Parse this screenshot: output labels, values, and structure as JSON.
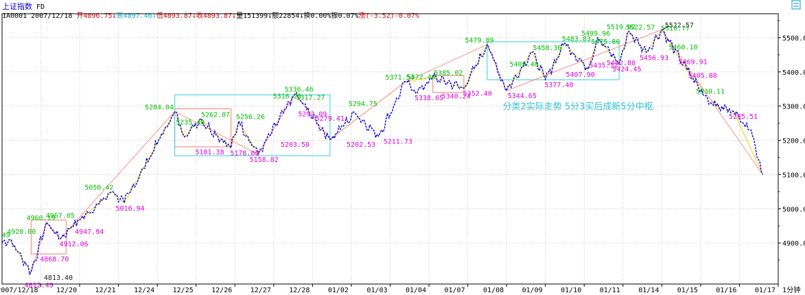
{
  "header": {
    "name": "上证指数",
    "type_code": "FD",
    "info": [
      {
        "text": "1A0001 2007/12/18 ",
        "color": "#000000"
      },
      {
        "text": "开4896.75↓",
        "color": "#e00000"
      },
      {
        "text": "高4897.46↓",
        "color": "#00b5d8"
      },
      {
        "text": "低4893.87↓",
        "color": "#e00000"
      },
      {
        "text": "收4893.87↓",
        "color": "#e00000"
      },
      {
        "text": "量151399↓",
        "color": "#000000"
      },
      {
        "text": "额22854↓",
        "color": "#000000"
      },
      {
        "text": "换0.00%",
        "color": "#000000"
      },
      {
        "text": "振0.07%",
        "color": "#000000"
      },
      {
        "text": "涨(-3.52)-0.07%",
        "color": "#e00000"
      }
    ],
    "corner_icon": "corner-scale-icon"
  },
  "chart_data": {
    "type": "line",
    "timeframe_label": "1分钟",
    "x_ticks": [
      "2007/12/18",
      "12/20",
      "12/21",
      "12/24",
      "12/25",
      "12/26",
      "12/27",
      "12/28",
      "01/02",
      "01/03",
      "01/04",
      "01/07",
      "01/08",
      "01/09",
      "01/10",
      "01/11",
      "01/14",
      "01/15",
      "01/16",
      "01/17"
    ],
    "ylim": [
      4780,
      5570
    ],
    "y_ticks": [
      4900,
      5000,
      5100,
      5200,
      5300,
      5400,
      5500
    ],
    "y_tick_labels": [
      "4900.00",
      "5000.00",
      "5100.00",
      "5200.00",
      "5300.00",
      "5400.00",
      "5500.00"
    ],
    "grid": true,
    "colors": {
      "price": "#0000e6",
      "stroke": "#e8d400",
      "segment": "#ff8a8a",
      "pivot_small": "#f08070",
      "pivot_big": "#30d0e0",
      "top_label": "#00c000",
      "bottom_label": "#e000e0",
      "note": "#30c0d8"
    },
    "stroke_points": [
      {
        "x": 0.2,
        "y": 4910
      },
      {
        "x": 0.75,
        "y": 4815
      },
      {
        "x": 1.15,
        "y": 4960
      },
      {
        "x": 1.5,
        "y": 4912
      },
      {
        "x": 1.8,
        "y": 4948
      },
      {
        "x": 2.85,
        "y": 5050
      },
      {
        "x": 3.15,
        "y": 5017
      },
      {
        "x": 4.45,
        "y": 5284
      },
      {
        "x": 4.7,
        "y": 5210
      },
      {
        "x": 5.1,
        "y": 5262
      },
      {
        "x": 5.9,
        "y": 5178
      },
      {
        "x": 6.1,
        "y": 5256
      },
      {
        "x": 6.6,
        "y": 5159
      },
      {
        "x": 7.55,
        "y": 5336
      },
      {
        "x": 8.45,
        "y": 5203
      },
      {
        "x": 10.4,
        "y": 5371
      },
      {
        "x": 11.1,
        "y": 5385
      },
      {
        "x": 11.9,
        "y": 5352
      },
      {
        "x": 12.5,
        "y": 5480
      },
      {
        "x": 13.0,
        "y": 5345
      },
      {
        "x": 13.65,
        "y": 5458
      },
      {
        "x": 14.0,
        "y": 5378
      },
      {
        "x": 14.5,
        "y": 5484
      },
      {
        "x": 15.1,
        "y": 5408
      },
      {
        "x": 15.35,
        "y": 5500
      },
      {
        "x": 15.9,
        "y": 5424
      },
      {
        "x": 16.15,
        "y": 5519
      },
      {
        "x": 16.6,
        "y": 5457
      },
      {
        "x": 17.0,
        "y": 5523
      },
      {
        "x": 17.65,
        "y": 5405
      },
      {
        "x": 18.4,
        "y": 5300
      },
      {
        "x": 18.85,
        "y": 5285
      },
      {
        "x": 19.6,
        "y": 5100
      }
    ],
    "segment_points": [
      {
        "x": 0.75,
        "y": 4815
      },
      {
        "x": 1.15,
        "y": 4960
      },
      {
        "x": 1.5,
        "y": 4912
      },
      {
        "x": 4.45,
        "y": 5284
      },
      {
        "x": 6.6,
        "y": 5159
      },
      {
        "x": 7.55,
        "y": 5336
      },
      {
        "x": 8.45,
        "y": 5203
      },
      {
        "x": 10.4,
        "y": 5371
      },
      {
        "x": 12.5,
        "y": 5480
      },
      {
        "x": 13.0,
        "y": 5345
      },
      {
        "x": 17.0,
        "y": 5523
      },
      {
        "x": 19.6,
        "y": 5100
      }
    ],
    "price_anchors": [
      {
        "x": 0,
        "y": 4900
      },
      {
        "x": 0.2,
        "y": 4910
      },
      {
        "x": 0.75,
        "y": 4815
      },
      {
        "x": 1.15,
        "y": 4960
      },
      {
        "x": 1.5,
        "y": 4912
      },
      {
        "x": 1.8,
        "y": 4948
      },
      {
        "x": 2.85,
        "y": 5050
      },
      {
        "x": 3.15,
        "y": 5017
      },
      {
        "x": 4.45,
        "y": 5284
      },
      {
        "x": 4.7,
        "y": 5210
      },
      {
        "x": 5.1,
        "y": 5262
      },
      {
        "x": 5.9,
        "y": 5178
      },
      {
        "x": 6.1,
        "y": 5256
      },
      {
        "x": 6.6,
        "y": 5159
      },
      {
        "x": 7.55,
        "y": 5336
      },
      {
        "x": 7.85,
        "y": 5290
      },
      {
        "x": 8.45,
        "y": 5203
      },
      {
        "x": 9.1,
        "y": 5280
      },
      {
        "x": 9.7,
        "y": 5212
      },
      {
        "x": 10.4,
        "y": 5371
      },
      {
        "x": 10.7,
        "y": 5339
      },
      {
        "x": 11.1,
        "y": 5385
      },
      {
        "x": 11.9,
        "y": 5352
      },
      {
        "x": 12.5,
        "y": 5480
      },
      {
        "x": 13.0,
        "y": 5345
      },
      {
        "x": 13.65,
        "y": 5458
      },
      {
        "x": 14.0,
        "y": 5378
      },
      {
        "x": 14.5,
        "y": 5484
      },
      {
        "x": 15.1,
        "y": 5408
      },
      {
        "x": 15.35,
        "y": 5500
      },
      {
        "x": 15.9,
        "y": 5424
      },
      {
        "x": 16.15,
        "y": 5519
      },
      {
        "x": 16.6,
        "y": 5457
      },
      {
        "x": 17.0,
        "y": 5523
      },
      {
        "x": 17.65,
        "y": 5405
      },
      {
        "x": 18.1,
        "y": 5330
      },
      {
        "x": 18.4,
        "y": 5300
      },
      {
        "x": 18.85,
        "y": 5285
      },
      {
        "x": 19.3,
        "y": 5230
      },
      {
        "x": 19.6,
        "y": 5100
      }
    ],
    "pivot_boxes": [
      {
        "kind": "small",
        "x0": 0.75,
        "x1": 1.65,
        "y0": 4868,
        "y1": 4967
      },
      {
        "kind": "small",
        "x0": 4.45,
        "x1": 5.9,
        "y0": 5181,
        "y1": 5292
      },
      {
        "kind": "big",
        "x0": 4.45,
        "x1": 8.45,
        "y0": 5155,
        "y1": 5333
      },
      {
        "kind": "small",
        "x0": 11.1,
        "x1": 11.9,
        "y0": 5340,
        "y1": 5389
      },
      {
        "kind": "big",
        "x0": 12.5,
        "x1": 15.9,
        "y0": 5377,
        "y1": 5488
      }
    ],
    "annotations": [
      {
        "text": "49",
        "x": 0.1,
        "y": 4910,
        "kind": "top"
      },
      {
        "text": "4920.00",
        "x": 0.5,
        "y": 4920,
        "kind": "top"
      },
      {
        "text": "4960.19",
        "x": 1.0,
        "y": 4960,
        "kind": "top"
      },
      {
        "text": "4967.05",
        "x": 1.5,
        "y": 4967,
        "kind": "top"
      },
      {
        "text": "4868.70",
        "x": 1.35,
        "y": 4868,
        "kind": "bottom"
      },
      {
        "text": "4912.06",
        "x": 1.85,
        "y": 4912,
        "kind": "bottom"
      },
      {
        "text": "4947.94",
        "x": 2.25,
        "y": 4948,
        "kind": "bottom"
      },
      {
        "text": "4812.49",
        "x": 0.95,
        "y": 4792,
        "kind": "bottom"
      },
      {
        "text": "4813.40",
        "x": 1.45,
        "y": 4800,
        "kind": "neutral"
      },
      {
        "text": "5050.42",
        "x": 2.5,
        "y": 5050,
        "kind": "top"
      },
      {
        "text": "5016.94",
        "x": 3.3,
        "y": 5017,
        "kind": "bottom"
      },
      {
        "text": "5284.04",
        "x": 4.05,
        "y": 5284,
        "kind": "top"
      },
      {
        "text": "5235.40",
        "x": 4.85,
        "y": 5240,
        "kind": "top"
      },
      {
        "text": "5262.07",
        "x": 5.5,
        "y": 5262,
        "kind": "top"
      },
      {
        "text": "5181.38",
        "x": 5.35,
        "y": 5181,
        "kind": "bottom"
      },
      {
        "text": "5178.00",
        "x": 6.25,
        "y": 5178,
        "kind": "bottom"
      },
      {
        "text": "5256.26",
        "x": 6.4,
        "y": 5256,
        "kind": "top"
      },
      {
        "text": "5158.82",
        "x": 6.75,
        "y": 5159,
        "kind": "bottom"
      },
      {
        "text": "5203.50",
        "x": 7.55,
        "y": 5203,
        "kind": "bottom"
      },
      {
        "text": "5336.46",
        "x": 7.65,
        "y": 5336,
        "kind": "top"
      },
      {
        "text": "5316.25",
        "x": 7.35,
        "y": 5316,
        "kind": "top"
      },
      {
        "text": "5317.27",
        "x": 7.95,
        "y": 5312,
        "kind": "top"
      },
      {
        "text": "5292.09",
        "x": 8.0,
        "y": 5292,
        "kind": "bottom"
      },
      {
        "text": "5279.41",
        "x": 8.45,
        "y": 5279,
        "kind": "bottom"
      },
      {
        "text": "5294.75",
        "x": 9.3,
        "y": 5294,
        "kind": "top"
      },
      {
        "text": "5202.53",
        "x": 9.25,
        "y": 5203,
        "kind": "bottom"
      },
      {
        "text": "5211.73",
        "x": 10.2,
        "y": 5212,
        "kind": "bottom"
      },
      {
        "text": "5371.54",
        "x": 10.25,
        "y": 5371,
        "kind": "top"
      },
      {
        "text": "5372.40",
        "x": 10.8,
        "y": 5372,
        "kind": "top"
      },
      {
        "text": "5338.65",
        "x": 11.0,
        "y": 5339,
        "kind": "bottom"
      },
      {
        "text": "5385.02",
        "x": 11.5,
        "y": 5385,
        "kind": "top"
      },
      {
        "text": "5340.24",
        "x": 11.7,
        "y": 5344,
        "kind": "bottom"
      },
      {
        "text": "5352.40",
        "x": 12.25,
        "y": 5352,
        "kind": "bottom"
      },
      {
        "text": "5479.89",
        "x": 12.3,
        "y": 5480,
        "kind": "top"
      },
      {
        "text": "5344.65",
        "x": 13.4,
        "y": 5345,
        "kind": "bottom"
      },
      {
        "text": "5409.40",
        "x": 13.45,
        "y": 5410,
        "kind": "top"
      },
      {
        "text": "5458.36",
        "x": 14.05,
        "y": 5458,
        "kind": "top"
      },
      {
        "text": "5377.40",
        "x": 14.35,
        "y": 5378,
        "kind": "bottom"
      },
      {
        "text": "5483.83",
        "x": 14.8,
        "y": 5484,
        "kind": "top"
      },
      {
        "text": "5499.96",
        "x": 15.3,
        "y": 5500,
        "kind": "top"
      },
      {
        "text": "5475.80",
        "x": 15.55,
        "y": 5476,
        "kind": "top"
      },
      {
        "text": "5407.90",
        "x": 14.9,
        "y": 5408,
        "kind": "bottom"
      },
      {
        "text": "5435.11",
        "x": 15.5,
        "y": 5435,
        "kind": "bottom"
      },
      {
        "text": "5442.80",
        "x": 15.95,
        "y": 5442,
        "kind": "bottom"
      },
      {
        "text": "5424.45",
        "x": 16.1,
        "y": 5424,
        "kind": "bottom"
      },
      {
        "text": "5519.02",
        "x": 15.95,
        "y": 5519,
        "kind": "top"
      },
      {
        "text": "5522.57",
        "x": 16.45,
        "y": 5518,
        "kind": "top"
      },
      {
        "text": "5456.93",
        "x": 16.8,
        "y": 5457,
        "kind": "bottom"
      },
      {
        "text": "5522.57",
        "x": 17.45,
        "y": 5538,
        "kind": "neutral"
      },
      {
        "text": "5510.77",
        "x": 17.35,
        "y": 5515,
        "kind": "top"
      },
      {
        "text": "5460.10",
        "x": 17.55,
        "y": 5460,
        "kind": "top"
      },
      {
        "text": "5469.91",
        "x": 17.8,
        "y": 5445,
        "kind": "bottom"
      },
      {
        "text": "5405.88",
        "x": 18.05,
        "y": 5405,
        "kind": "bottom"
      },
      {
        "text": "5330.11",
        "x": 18.25,
        "y": 5330,
        "kind": "top"
      },
      {
        "text": "5285.51",
        "x": 19.1,
        "y": 5285,
        "kind": "bottom"
      }
    ],
    "note": "分类2实际走势 5分3买后成新5分中枢"
  }
}
